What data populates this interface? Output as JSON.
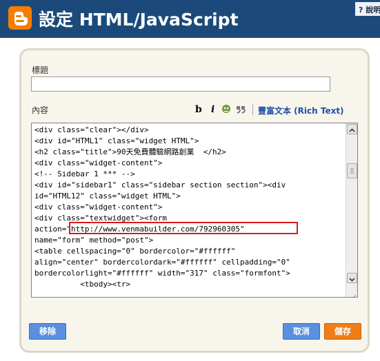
{
  "header": {
    "title": "設定 HTML/JavaScript",
    "help_label": "? 說明"
  },
  "form": {
    "title_label": "標題",
    "title_value": "",
    "content_label": "內容",
    "toolbar": {
      "bold": "b",
      "italic": "i",
      "rich_text_link": "豐富文本 (Rich Text)"
    },
    "code_lines": [
      "<div class=\"clear\"></div>",
      "<div id=\"HTML1\" class=\"widget HTML\">",
      "<h2 class=\"title\">90天免費體驗網路創業  </h2>",
      "<div class=\"widget-content\">",
      "<!-- Sidebar 1 *** -->",
      "<div id=\"sidebar1\" class=\"sidebar section section\"><div",
      "id=\"HTML12\" class=\"widget HTML\">",
      "<div class=\"widget-content\">",
      "<div class=\"textwidget\"><form",
      "action=\"http://www.venmabuilder.com/792960305\"",
      "name=\"form\" method=\"post\">",
      "<table cellspacing=\"0\" bordercolor=\"#ffffff\"",
      "align=\"center\" bordercolordark=\"#ffffff\" cellpadding=\"0\"",
      "bordercolorlight=\"#ffffff\" width=\"317\" class=\"formfont\">",
      "          <tbody><tr>"
    ]
  },
  "buttons": {
    "remove": "移除",
    "cancel": "取消",
    "save": "儲存"
  },
  "colors": {
    "header_bg": "#1b4a7a",
    "logo": "#f57d00",
    "highlight": "#d71920",
    "blue_button": "#5b8fe0",
    "orange_button": "#f07d15"
  }
}
